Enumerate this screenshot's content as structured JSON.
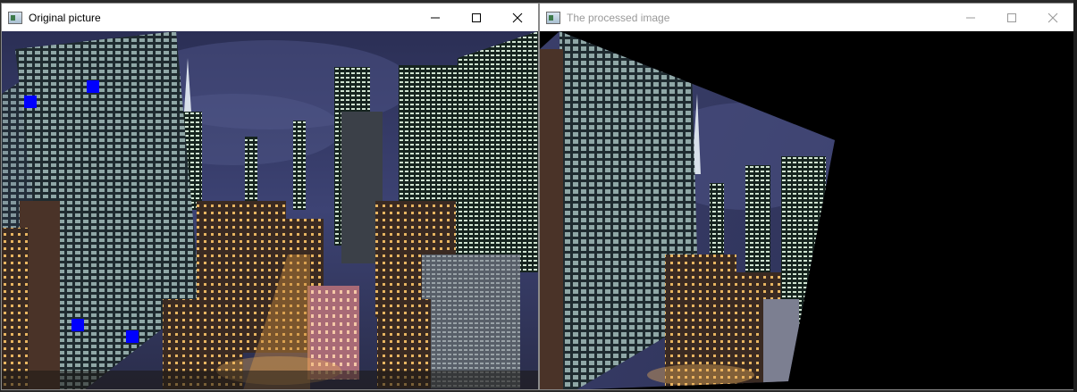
{
  "left_window": {
    "title": "Original picture",
    "state": "active"
  },
  "right_window": {
    "title": "The processed image",
    "state": "inactive"
  },
  "caption_buttons": [
    "minimize",
    "maximize",
    "close"
  ],
  "icons": {
    "app": "opencv-window-icon",
    "minimize": "minimize-icon",
    "maximize": "maximize-icon",
    "close": "close-icon"
  },
  "colors": {
    "marker": "#0000ff",
    "titlebar_active": "#ffffff",
    "title_inactive_text": "#999999",
    "canvas_background": "#000000"
  },
  "images": {
    "original": "city skyline at night with tall glass skyscrapers and four blue corner markers",
    "processed": "perspective-warped version of the skyline on a black background"
  }
}
